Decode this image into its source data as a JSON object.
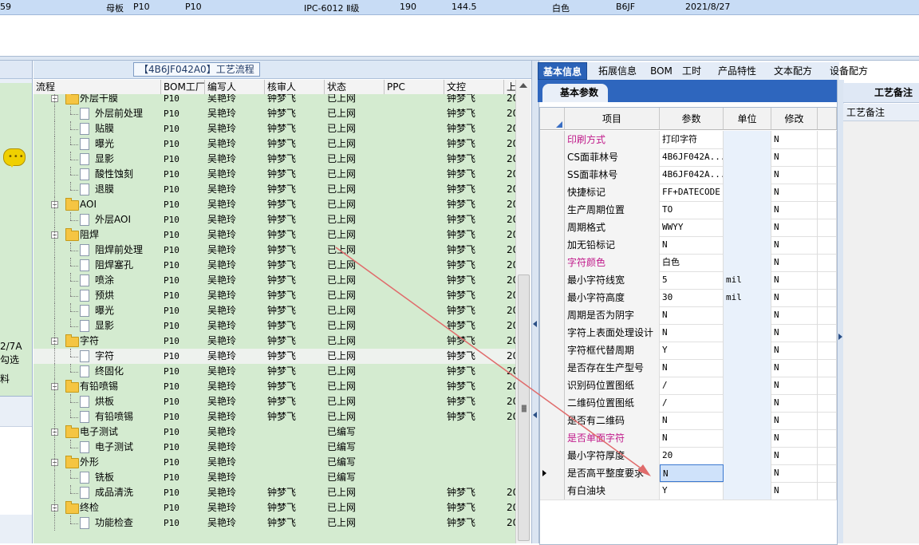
{
  "top_record": {
    "prefix": "59",
    "board": "母板",
    "plant1": "P10",
    "plant2": "P10",
    "grade": "IPC-6012 Ⅱ级",
    "v1": "190",
    "v2": "144.5",
    "color": "白色",
    "code": "B6JF",
    "date": "2021/8/27"
  },
  "left_fragment": {
    "label1": "2/7A",
    "label2": "勾选",
    "label3": "料"
  },
  "process_tree": {
    "title": "【4B6JF042A0】工艺流程",
    "columns": [
      "流程",
      "BOM工厂",
      "编写人",
      "核审人",
      "状态",
      "PPC",
      "文控",
      "上"
    ],
    "rows": [
      {
        "name": "外层干膜",
        "level": 0,
        "plant": "P10",
        "writer": "吴艳玲",
        "reviewer": "钟梦飞",
        "status": "已上网",
        "ctrl": "钟梦飞",
        "last": "20"
      },
      {
        "name": "外层前处理",
        "level": 1,
        "plant": "P10",
        "writer": "吴艳玲",
        "reviewer": "钟梦飞",
        "status": "已上网",
        "ctrl": "钟梦飞",
        "last": "20"
      },
      {
        "name": "贴膜",
        "level": 1,
        "plant": "P10",
        "writer": "吴艳玲",
        "reviewer": "钟梦飞",
        "status": "已上网",
        "ctrl": "钟梦飞",
        "last": "20"
      },
      {
        "name": "曝光",
        "level": 1,
        "plant": "P10",
        "writer": "吴艳玲",
        "reviewer": "钟梦飞",
        "status": "已上网",
        "ctrl": "钟梦飞",
        "last": "20"
      },
      {
        "name": "显影",
        "level": 1,
        "plant": "P10",
        "writer": "吴艳玲",
        "reviewer": "钟梦飞",
        "status": "已上网",
        "ctrl": "钟梦飞",
        "last": "20"
      },
      {
        "name": "酸性蚀刻",
        "level": 1,
        "plant": "P10",
        "writer": "吴艳玲",
        "reviewer": "钟梦飞",
        "status": "已上网",
        "ctrl": "钟梦飞",
        "last": "20"
      },
      {
        "name": "退膜",
        "level": 1,
        "plant": "P10",
        "writer": "吴艳玲",
        "reviewer": "钟梦飞",
        "status": "已上网",
        "ctrl": "钟梦飞",
        "last": "20"
      },
      {
        "name": "AOI",
        "level": 0,
        "plant": "P10",
        "writer": "吴艳玲",
        "reviewer": "钟梦飞",
        "status": "已上网",
        "ctrl": "钟梦飞",
        "last": "20"
      },
      {
        "name": "外层AOI",
        "level": 1,
        "plant": "P10",
        "writer": "吴艳玲",
        "reviewer": "钟梦飞",
        "status": "已上网",
        "ctrl": "钟梦飞",
        "last": "20"
      },
      {
        "name": "阻焊",
        "level": 0,
        "plant": "P10",
        "writer": "吴艳玲",
        "reviewer": "钟梦飞",
        "status": "已上网",
        "ctrl": "钟梦飞",
        "last": "20"
      },
      {
        "name": "阻焊前处理",
        "level": 1,
        "plant": "P10",
        "writer": "吴艳玲",
        "reviewer": "钟梦飞",
        "status": "已上网",
        "ctrl": "钟梦飞",
        "last": "20"
      },
      {
        "name": "阻焊塞孔",
        "level": 1,
        "plant": "P10",
        "writer": "吴艳玲",
        "reviewer": "钟梦飞",
        "status": "已上网",
        "ctrl": "钟梦飞",
        "last": "20"
      },
      {
        "name": "喷涂",
        "level": 1,
        "plant": "P10",
        "writer": "吴艳玲",
        "reviewer": "钟梦飞",
        "status": "已上网",
        "ctrl": "钟梦飞",
        "last": "20"
      },
      {
        "name": "预烘",
        "level": 1,
        "plant": "P10",
        "writer": "吴艳玲",
        "reviewer": "钟梦飞",
        "status": "已上网",
        "ctrl": "钟梦飞",
        "last": "20"
      },
      {
        "name": "曝光",
        "level": 1,
        "plant": "P10",
        "writer": "吴艳玲",
        "reviewer": "钟梦飞",
        "status": "已上网",
        "ctrl": "钟梦飞",
        "last": "20"
      },
      {
        "name": "显影",
        "level": 1,
        "plant": "P10",
        "writer": "吴艳玲",
        "reviewer": "钟梦飞",
        "status": "已上网",
        "ctrl": "钟梦飞",
        "last": "20"
      },
      {
        "name": "字符",
        "level": 0,
        "plant": "P10",
        "writer": "吴艳玲",
        "reviewer": "钟梦飞",
        "status": "已上网",
        "ctrl": "钟梦飞",
        "last": "20"
      },
      {
        "name": "字符",
        "level": 1,
        "plant": "P10",
        "writer": "吴艳玲",
        "reviewer": "钟梦飞",
        "status": "已上网",
        "ctrl": "钟梦飞",
        "last": "20",
        "selected": true
      },
      {
        "name": "终固化",
        "level": 1,
        "plant": "P10",
        "writer": "吴艳玲",
        "reviewer": "钟梦飞",
        "status": "已上网",
        "ctrl": "钟梦飞",
        "last": "20"
      },
      {
        "name": "有铅喷锡",
        "level": 0,
        "plant": "P10",
        "writer": "吴艳玲",
        "reviewer": "钟梦飞",
        "status": "已上网",
        "ctrl": "钟梦飞",
        "last": "20"
      },
      {
        "name": "烘板",
        "level": 1,
        "plant": "P10",
        "writer": "吴艳玲",
        "reviewer": "钟梦飞",
        "status": "已上网",
        "ctrl": "钟梦飞",
        "last": "20"
      },
      {
        "name": "有铅喷锡",
        "level": 1,
        "plant": "P10",
        "writer": "吴艳玲",
        "reviewer": "钟梦飞",
        "status": "已上网",
        "ctrl": "钟梦飞",
        "last": "20"
      },
      {
        "name": "电子测试",
        "level": 0,
        "plant": "P10",
        "writer": "吴艳玲",
        "reviewer": "",
        "status": "已编写",
        "ctrl": "",
        "last": ""
      },
      {
        "name": "电子测试",
        "level": 1,
        "plant": "P10",
        "writer": "吴艳玲",
        "reviewer": "",
        "status": "已编写",
        "ctrl": "",
        "last": ""
      },
      {
        "name": "外形",
        "level": 0,
        "plant": "P10",
        "writer": "吴艳玲",
        "reviewer": "",
        "status": "已编写",
        "ctrl": "",
        "last": ""
      },
      {
        "name": "铣板",
        "level": 1,
        "plant": "P10",
        "writer": "吴艳玲",
        "reviewer": "",
        "status": "已编写",
        "ctrl": "",
        "last": ""
      },
      {
        "name": "成品清洗",
        "level": 1,
        "plant": "P10",
        "writer": "吴艳玲",
        "reviewer": "钟梦飞",
        "status": "已上网",
        "ctrl": "钟梦飞",
        "last": "20"
      },
      {
        "name": "终检",
        "level": 0,
        "plant": "P10",
        "writer": "吴艳玲",
        "reviewer": "钟梦飞",
        "status": "已上网",
        "ctrl": "钟梦飞",
        "last": "20"
      },
      {
        "name": "功能检查",
        "level": 1,
        "plant": "P10",
        "writer": "吴艳玲",
        "reviewer": "钟梦飞",
        "status": "已上网",
        "ctrl": "钟梦飞",
        "last": "20"
      }
    ]
  },
  "tabs": [
    "基本信息",
    "拓展信息",
    "BOM",
    "工时",
    "产品特性",
    "文本配方",
    "设备配方"
  ],
  "active_tab": "基本信息",
  "subtab": "基本参数",
  "param_grid": {
    "columns": [
      "项目",
      "参数",
      "单位",
      "修改"
    ],
    "rows": [
      {
        "item": "印刷方式",
        "param": "打印字符",
        "unit": "",
        "mod": "N",
        "pink": true
      },
      {
        "item": "CS面菲林号",
        "param": "4B6JF042A...",
        "unit": "",
        "mod": "N"
      },
      {
        "item": "SS面菲林号",
        "param": "4B6JF042A...",
        "unit": "",
        "mod": "N"
      },
      {
        "item": "快捷标记",
        "param": "FF+DATECODE",
        "unit": "",
        "mod": "N"
      },
      {
        "item": "生产周期位置",
        "param": "TO",
        "unit": "",
        "mod": "N"
      },
      {
        "item": "周期格式",
        "param": "WWYY",
        "unit": "",
        "mod": "N"
      },
      {
        "item": "加无铅标记",
        "param": "N",
        "unit": "",
        "mod": "N"
      },
      {
        "item": "字符颜色",
        "param": "白色",
        "unit": "",
        "mod": "N",
        "pink": true
      },
      {
        "item": "最小字符线宽",
        "param": "5",
        "unit": "mil",
        "mod": "N"
      },
      {
        "item": "最小字符高度",
        "param": "30",
        "unit": "mil",
        "mod": "N"
      },
      {
        "item": "周期是否为阴字",
        "param": "N",
        "unit": "",
        "mod": "N"
      },
      {
        "item": "字符上表面处理设计",
        "param": "N",
        "unit": "",
        "mod": "N"
      },
      {
        "item": "字符框代替周期",
        "param": "Y",
        "unit": "",
        "mod": "N"
      },
      {
        "item": "是否存在生产型号",
        "param": "N",
        "unit": "",
        "mod": "N"
      },
      {
        "item": "识别码位置图纸",
        "param": "/",
        "unit": "",
        "mod": "N"
      },
      {
        "item": "二维码位置图纸",
        "param": "/",
        "unit": "",
        "mod": "N"
      },
      {
        "item": "是否有二维码",
        "param": "N",
        "unit": "",
        "mod": "N"
      },
      {
        "item": "是否单面字符",
        "param": "N",
        "unit": "",
        "mod": "N",
        "pink": true
      },
      {
        "item": "最小字符厚度",
        "param": "20",
        "unit": "",
        "mod": "N"
      },
      {
        "item": "是否高平整度要求",
        "param": "N",
        "unit": "",
        "mod": "N",
        "editing": true,
        "current": true
      },
      {
        "item": "有白油块",
        "param": "Y",
        "unit": "",
        "mod": "N"
      }
    ]
  },
  "notes_panel": {
    "title": "工艺备注",
    "column": "工艺备注"
  },
  "colors": {
    "tree_bg": "#d4ebd0",
    "active_tab": "#2a62b8",
    "pink_label": "#c0198a",
    "annotation_arrow": "#e06b6b"
  }
}
